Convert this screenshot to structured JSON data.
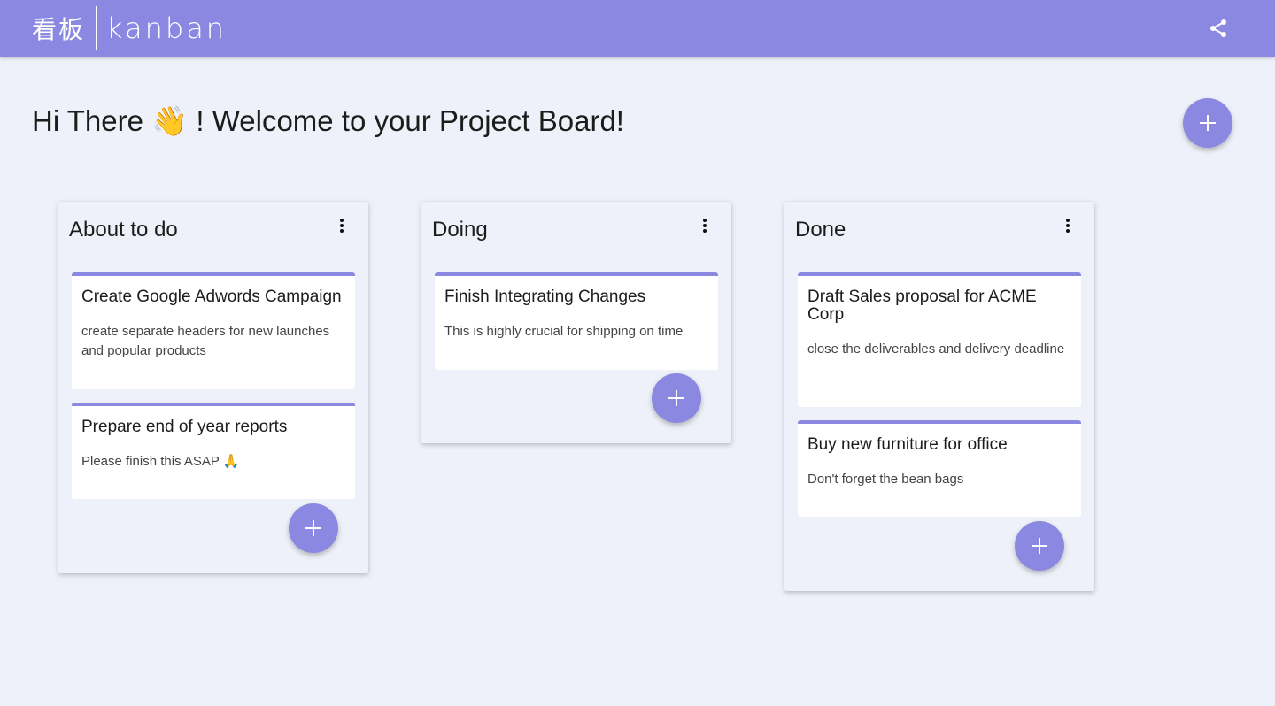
{
  "topbar": {
    "brand_cn": "看板",
    "brand_en": "kanban",
    "share_icon": "share-icon",
    "color": "#8b88e2"
  },
  "heading": {
    "text": "Hi There 👋 ! Welcome to your Project Board!"
  },
  "add_icon": "plus-icon",
  "more_icon": "more-vertical-icon",
  "accent_color": "#8b88e2",
  "columns": [
    {
      "title": "About to do",
      "cards": [
        {
          "title": "Create Google Adwords Campaign",
          "description": "create separate headers for new launches and popular products"
        },
        {
          "title": "Prepare end of year reports",
          "description": "Please finish this ASAP 🙏"
        }
      ]
    },
    {
      "title": "Doing",
      "cards": [
        {
          "title": "Finish Integrating Changes",
          "description": "This is highly crucial for shipping on time"
        }
      ]
    },
    {
      "title": "Done",
      "cards": [
        {
          "title": "Draft Sales proposal for ACME Corp",
          "description": "close the deliverables and delivery deadline"
        },
        {
          "title": "Buy new furniture for office",
          "description": "Don't forget the bean bags"
        }
      ]
    }
  ]
}
